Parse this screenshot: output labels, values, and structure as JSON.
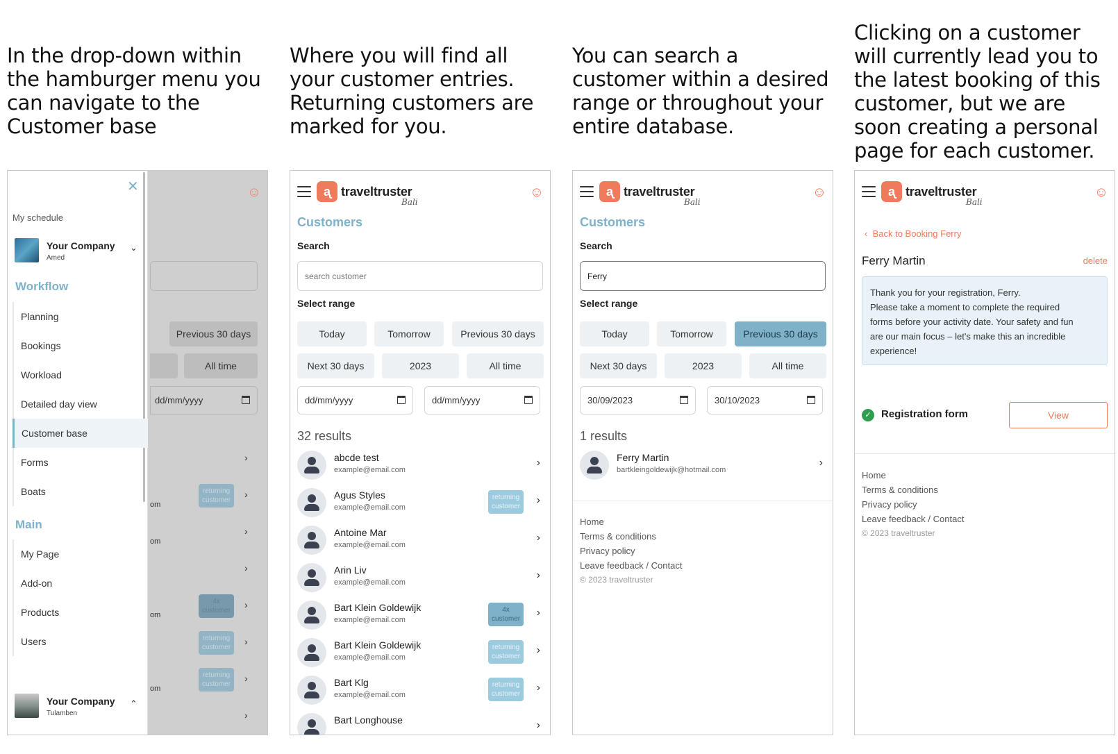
{
  "captions": [
    "In the drop-down within the hamburger menu you can navigate to the Customer base",
    "Where you will find all your customer entries. Returning customers are marked for you.",
    "You can search a customer within a desired range or throughout your entire database.",
    "Clicking on a customer will currently lead you to the latest booking of this customer, but we are soon creating a personal page for each customer."
  ],
  "brand": {
    "name": "traveltruster",
    "sub": "Bali",
    "accent": "#f07a5c",
    "secondary": "#7fb1c9"
  },
  "drawer": {
    "schedule_label": "My schedule",
    "company_top": {
      "name": "Your Company",
      "sub": "Amed"
    },
    "workflow_title": "Workflow",
    "workflow_items": [
      "Planning",
      "Bookings",
      "Workload",
      "Detailed day view",
      "Customer base",
      "Forms",
      "Boats"
    ],
    "main_title": "Main",
    "main_items": [
      "My Page",
      "Add-on",
      "Products",
      "Users"
    ],
    "company_bottom": {
      "name": "Your Company",
      "sub": "Tulamben"
    }
  },
  "behind": {
    "prev30": "Previous 30 days",
    "alltime": "All time",
    "date_placeholder": "dd/mm/yyyy",
    "frag_om": "om",
    "badge_returning": [
      "returning",
      "customer"
    ],
    "badge_4x": [
      "4x",
      "customer"
    ]
  },
  "customers_page": {
    "title": "Customers",
    "search_label": "Search",
    "search_placeholder": "search customer",
    "range_label": "Select range",
    "ranges": [
      "Today",
      "Tomorrow",
      "Previous 30 days",
      "Next 30 days",
      "2023",
      "All time"
    ],
    "date_placeholder": "dd/mm/yyyy",
    "results": "32 results",
    "list": [
      {
        "name": "abcde test",
        "email": "example@email.com",
        "badge": null
      },
      {
        "name": "Agus Styles",
        "email": "example@email.com",
        "badge": [
          "returning",
          "customer"
        ]
      },
      {
        "name": "Antoine Mar",
        "email": "example@email.com",
        "badge": null
      },
      {
        "name": "Arin Liv",
        "email": "example@email.com",
        "badge": null
      },
      {
        "name": "Bart Klein Goldewijk",
        "email": "example@email.com",
        "badge": [
          "4x",
          "customer"
        ]
      },
      {
        "name": "Bart Klein Goldewijk",
        "email": "example@email.com",
        "badge": [
          "returning",
          "customer"
        ]
      },
      {
        "name": "Bart Klg",
        "email": "example@email.com",
        "badge": [
          "returning",
          "customer"
        ]
      },
      {
        "name": "Bart Longhouse",
        "email": "",
        "badge": null
      }
    ]
  },
  "search_page": {
    "search_value": "Ferry",
    "active_range": "Previous 30 days",
    "date_from": "30/09/2023",
    "date_to": "30/10/2023",
    "results": "1 results",
    "result": {
      "name": "Ferry Martin",
      "email": "bartkleingoldewijk@hotmail.com"
    }
  },
  "footer": {
    "links": [
      "Home",
      "Terms & conditions",
      "Privacy policy",
      "Leave feedback / Contact"
    ],
    "copyright": "© 2023 traveltruster"
  },
  "detail_page": {
    "back": "Back to Booking Ferry",
    "name": "Ferry Martin",
    "delete": "delete",
    "message_lines": [
      "Thank you for your registration, Ferry.",
      "Please take a moment to complete the required",
      "forms before your activity date. Your safety and fun",
      "are our main focus – let's make this an incredible",
      "experience!"
    ],
    "form_label": "Registration form",
    "view_button": "View"
  }
}
